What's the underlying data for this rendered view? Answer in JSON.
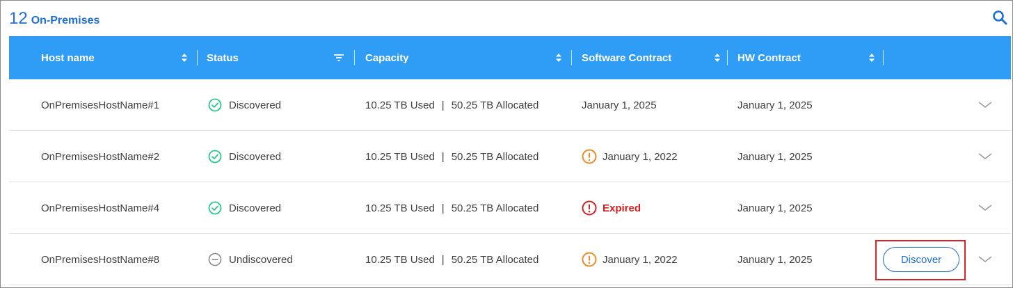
{
  "header": {
    "count": "12",
    "title": "On-Premises",
    "search_icon": "search-icon"
  },
  "columns": [
    {
      "key": "host",
      "label": "Host name",
      "control_icon": "sort-icon"
    },
    {
      "key": "status",
      "label": "Status",
      "control_icon": "filter-icon"
    },
    {
      "key": "capacity",
      "label": "Capacity",
      "control_icon": "sort-icon"
    },
    {
      "key": "software",
      "label": "Software Contract",
      "control_icon": "sort-icon"
    },
    {
      "key": "hw",
      "label": "HW Contract",
      "control_icon": "sort-icon"
    }
  ],
  "rows": [
    {
      "host": "OnPremisesHostName#1",
      "status": "Discovered",
      "status_icon": "check-circle-icon",
      "capacity_used": "10.25 TB Used",
      "capacity_sep": "|",
      "capacity_allocated": "50.25 TB Allocated",
      "software": "January 1, 2025",
      "software_state": "ok",
      "hw": "January 1, 2025"
    },
    {
      "host": "OnPremisesHostName#2",
      "status": "Discovered",
      "status_icon": "check-circle-icon",
      "capacity_used": "10.25 TB Used",
      "capacity_sep": "|",
      "capacity_allocated": "50.25 TB Allocated",
      "software": "January 1, 2022",
      "software_state": "warning",
      "hw": "January 1, 2025"
    },
    {
      "host": "OnPremisesHostName#4",
      "status": "Discovered",
      "status_icon": "check-circle-icon",
      "capacity_used": "10.25 TB Used",
      "capacity_sep": "|",
      "capacity_allocated": "50.25 TB Allocated",
      "software": "Expired",
      "software_state": "expired",
      "hw": "January 1, 2025"
    },
    {
      "host": "OnPremisesHostName#8",
      "status": "Undiscovered",
      "status_icon": "minus-circle-icon",
      "capacity_used": "10.25 TB Used",
      "capacity_sep": "|",
      "capacity_allocated": "50.25 TB Allocated",
      "software": "January 1, 2022",
      "software_state": "warning",
      "hw": "January 1, 2025",
      "action_label": "Discover"
    }
  ],
  "colors": {
    "accent": "#1d6fd6",
    "header_bg": "#2f9df6",
    "success": "#2bc48a",
    "warning": "#f08a24",
    "error": "#d42020",
    "highlight": "#d8232a",
    "neutral_icon": "#8a8a8a"
  }
}
